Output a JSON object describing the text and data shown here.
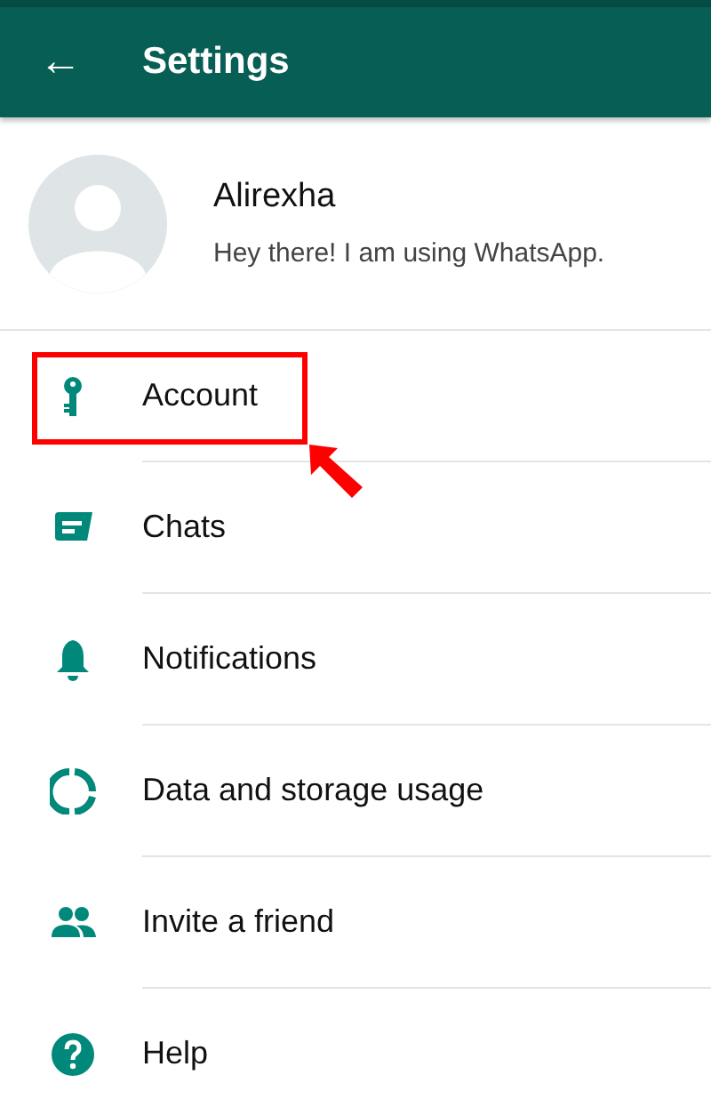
{
  "header": {
    "back": "←",
    "title": "Settings"
  },
  "profile": {
    "name": "Alirexha",
    "status": "Hey there! I am using WhatsApp."
  },
  "items": [
    {
      "kind": "key",
      "label": "Account",
      "highlighted": true
    },
    {
      "kind": "chat",
      "label": "Chats",
      "highlighted": false
    },
    {
      "kind": "bell",
      "label": "Notifications",
      "highlighted": false
    },
    {
      "kind": "data",
      "label": "Data and storage usage",
      "highlighted": false
    },
    {
      "kind": "people",
      "label": "Invite a friend",
      "highlighted": false
    },
    {
      "kind": "help",
      "label": "Help",
      "highlighted": false
    }
  ]
}
